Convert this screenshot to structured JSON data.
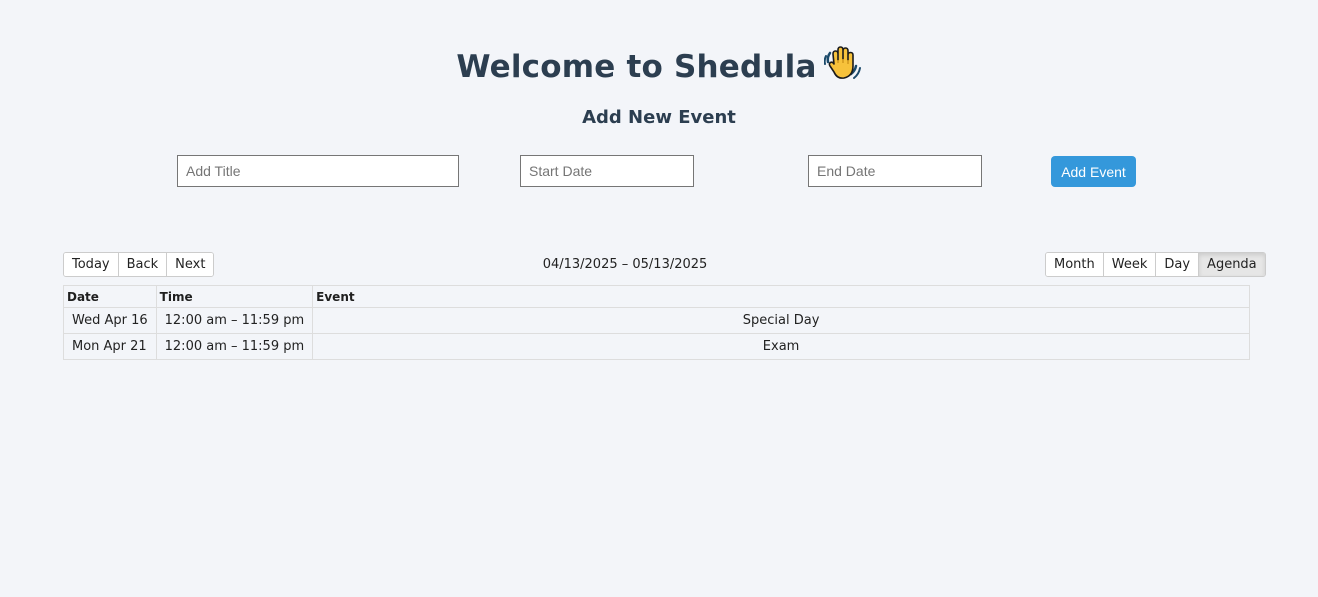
{
  "header": {
    "title": "Welcome to Shedula",
    "icon": "waving-hand-icon"
  },
  "form": {
    "heading": "Add New Event",
    "title_placeholder": "Add Title",
    "start_placeholder": "Start Date",
    "end_placeholder": "End Date",
    "submit_label": "Add Event",
    "accent_color": "#3498db"
  },
  "toolbar": {
    "today": "Today",
    "back": "Back",
    "next": "Next",
    "range": "04/13/2025 – 05/13/2025",
    "views": {
      "month": "Month",
      "week": "Week",
      "day": "Day",
      "agenda": "Agenda"
    },
    "active_view": "Agenda"
  },
  "agenda": {
    "headers": {
      "date": "Date",
      "time": "Time",
      "event": "Event"
    },
    "rows": [
      {
        "date": "Wed Apr 16",
        "time": "12:00 am – 11:59 pm",
        "event": "Special Day"
      },
      {
        "date": "Mon Apr 21",
        "time": "12:00 am – 11:59 pm",
        "event": "Exam"
      }
    ]
  }
}
